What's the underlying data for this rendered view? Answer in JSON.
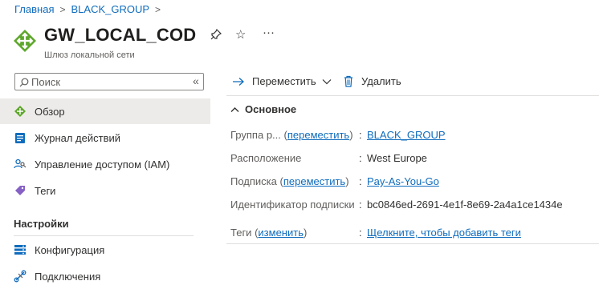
{
  "breadcrumb": {
    "home": "Главная",
    "group": "BLACK_GROUP"
  },
  "header": {
    "title": "GW_LOCAL_COD",
    "subtitle": "Шлюз локальной сети",
    "more": "···"
  },
  "search": {
    "placeholder": "Поиск"
  },
  "sidebar": {
    "items": [
      {
        "label": "Обзор",
        "icon": "overview-icon"
      },
      {
        "label": "Журнал действий",
        "icon": "activity-log-icon"
      },
      {
        "label": "Управление доступом (IAM)",
        "icon": "iam-icon"
      },
      {
        "label": "Теги",
        "icon": "tag-icon"
      }
    ],
    "settings_title": "Настройки",
    "settings_items": [
      {
        "label": "Конфигурация",
        "icon": "configuration-icon"
      },
      {
        "label": "Подключения",
        "icon": "connections-icon"
      }
    ]
  },
  "toolbar": {
    "move": "Переместить",
    "delete": "Удалить"
  },
  "essentials": {
    "title": "Основное",
    "resource_group_label": "Группа р...",
    "move_link": "переместить",
    "resource_group_value": "BLACK_GROUP",
    "location_label": "Расположение",
    "location_value": "West Europe",
    "subscription_label": "Подписка",
    "subscription_value": "Pay-As-You-Go",
    "subscription_id_label": "Идентификатор подписки",
    "subscription_id_value": "bc0846ed-2691-4e1f-8e69-2a4a1ce1434e",
    "tags_label": "Теги",
    "tags_edit": "изменить",
    "tags_value": "Щелкните, чтобы добавить теги"
  },
  "colors": {
    "accent": "#0f6cbd",
    "gateway_green": "#5ea72c"
  }
}
